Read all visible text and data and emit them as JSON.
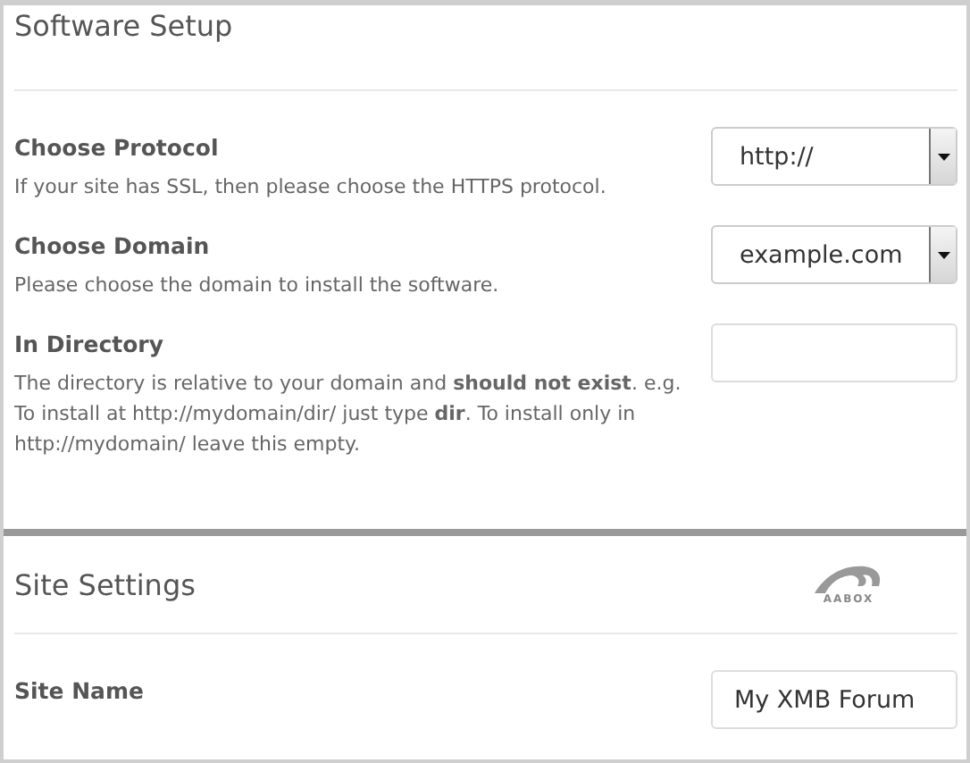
{
  "sections": [
    {
      "title": "Software Setup",
      "fields": [
        {
          "kind": "select",
          "label": "Choose Protocol",
          "description": "If your site has SSL, then please choose the HTTPS protocol.",
          "value": "http://"
        },
        {
          "kind": "select",
          "label": "Choose Domain",
          "description": "Please choose the domain to install the software.",
          "value": "example.com"
        },
        {
          "kind": "text",
          "label": "In Directory",
          "description": "The directory is relative to your domain and **should not exist**. e.g. To install at http://mydomain/dir/ just type **dir**. To install only in http://mydomain/ leave this empty."
        }
      ]
    },
    {
      "title": "Site Settings",
      "logo": "AABOX",
      "fields": [
        {
          "kind": "text",
          "label": "Site Name",
          "value": "My XMB Forum"
        }
      ]
    }
  ]
}
